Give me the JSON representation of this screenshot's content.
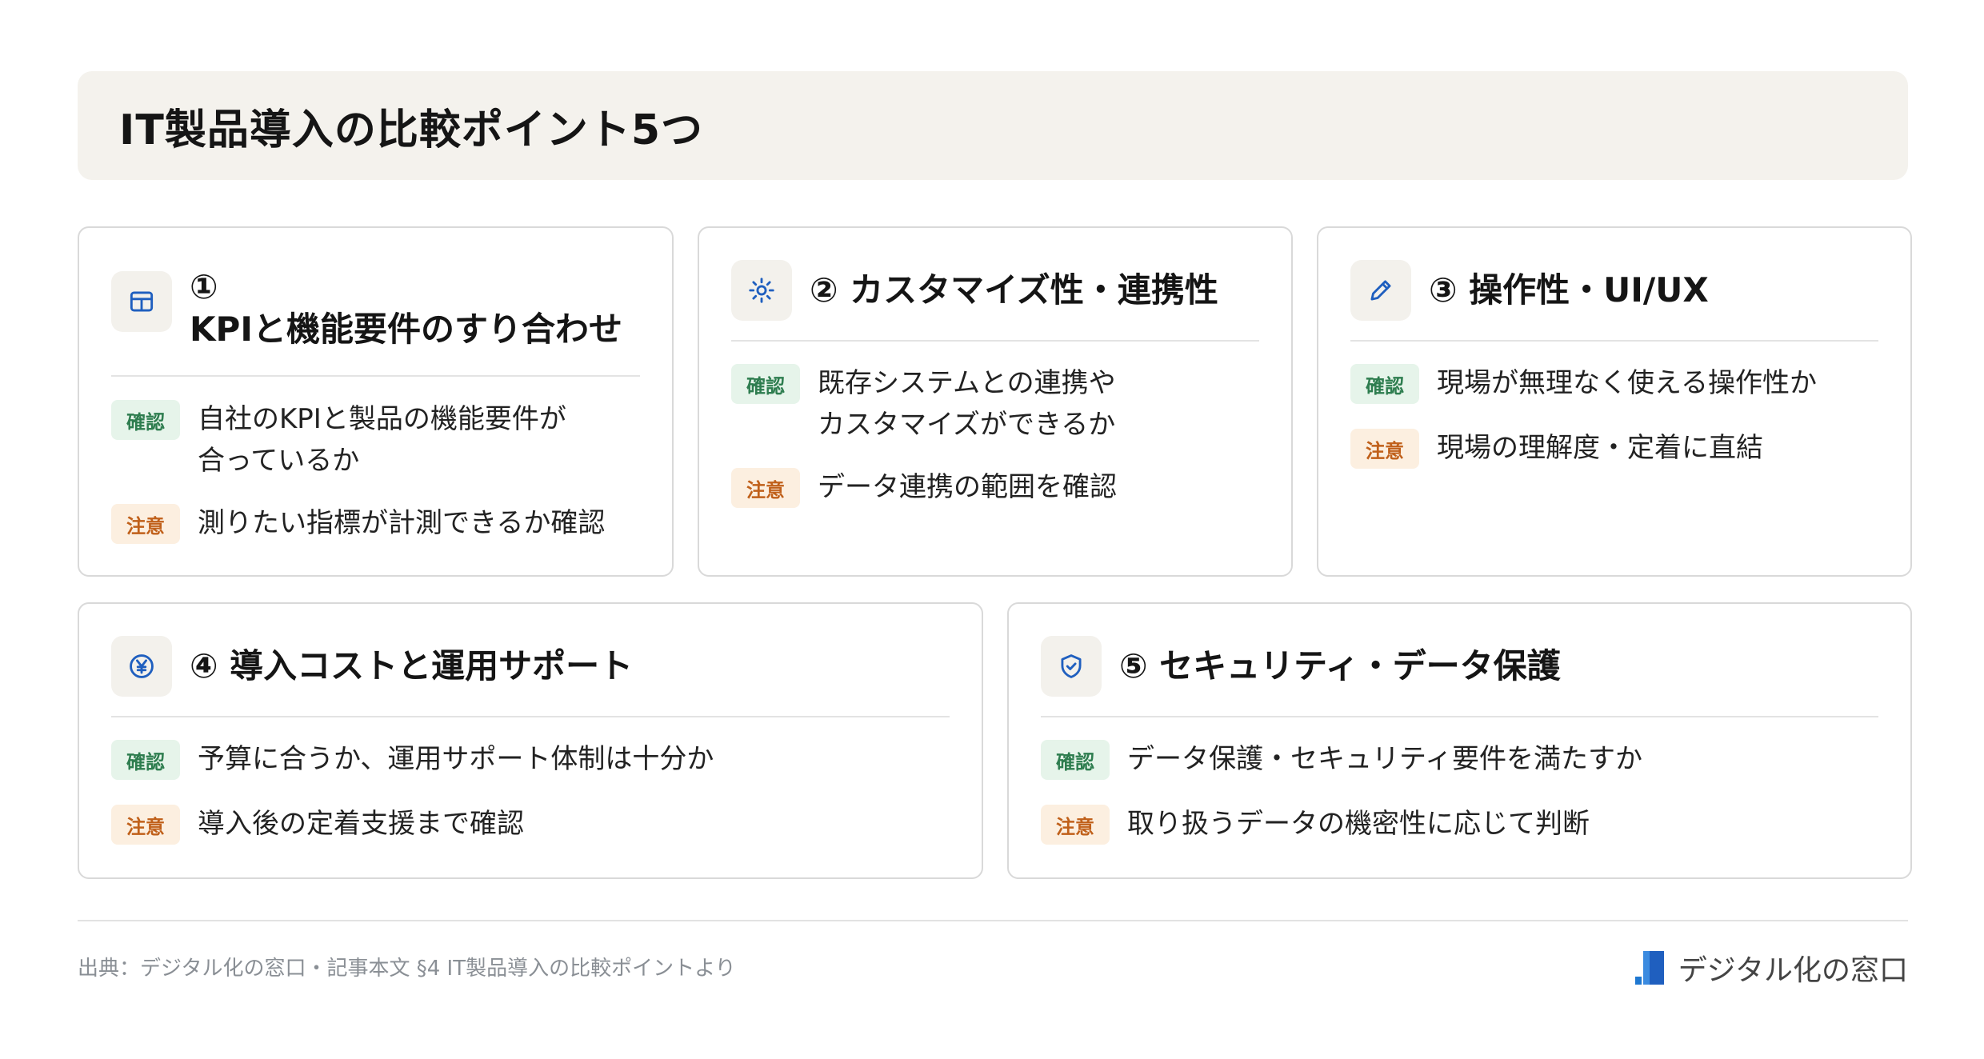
{
  "title": "IT製品導入の比較ポイント5つ",
  "cards": [
    {
      "title": "①\nKPIと機能要件のすり合わせ",
      "icon": "table-icon",
      "confirm_label": "確認",
      "confirm_text": "自社のKPIと製品の機能要件が\n合っているか",
      "caution_label": "注意",
      "caution_text": "測りたい指標が計測できるか確認"
    },
    {
      "title": "② カスタマイズ性・連携性",
      "icon": "gear-icon",
      "confirm_label": "確認",
      "confirm_text": "既存システムとの連携や\nカスタマイズができるか",
      "caution_label": "注意",
      "caution_text": "データ連携の範囲を確認"
    },
    {
      "title": "③ 操作性・UI/UX",
      "icon": "pencil-icon",
      "confirm_label": "確認",
      "confirm_text": "現場が無理なく使える操作性か",
      "caution_label": "注意",
      "caution_text": "現場の理解度・定着に直結"
    },
    {
      "title": "④ 導入コストと運用サポート",
      "icon": "yen-icon",
      "confirm_label": "確認",
      "confirm_text": "予算に合うか、運用サポート体制は十分か",
      "caution_label": "注意",
      "caution_text": "導入後の定着支援まで確認"
    },
    {
      "title": "⑤ セキュリティ・データ保護",
      "icon": "shield-icon",
      "confirm_label": "確認",
      "confirm_text": "データ保護・セキュリティ要件を満たすか",
      "caution_label": "注意",
      "caution_text": "取り扱うデータの機密性に応じて判断"
    }
  ],
  "footer": {
    "source": "出典：デジタル化の窓口・記事本文 §4 IT製品導入の比較ポイントより",
    "brand": "デジタル化の窓口"
  },
  "colors": {
    "icon_blue": "#1f5fbf",
    "confirm_green": "#2e7d4f",
    "caution_orange": "#c0601a"
  }
}
